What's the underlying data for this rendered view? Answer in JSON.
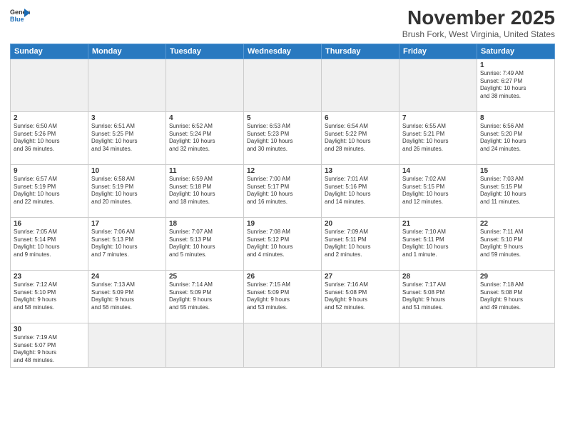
{
  "header": {
    "logo_general": "General",
    "logo_blue": "Blue",
    "month": "November 2025",
    "location": "Brush Fork, West Virginia, United States"
  },
  "weekdays": [
    "Sunday",
    "Monday",
    "Tuesday",
    "Wednesday",
    "Thursday",
    "Friday",
    "Saturday"
  ],
  "weeks": [
    [
      {
        "day": "",
        "info": "",
        "empty": true
      },
      {
        "day": "",
        "info": "",
        "empty": true
      },
      {
        "day": "",
        "info": "",
        "empty": true
      },
      {
        "day": "",
        "info": "",
        "empty": true
      },
      {
        "day": "",
        "info": "",
        "empty": true
      },
      {
        "day": "",
        "info": "",
        "empty": true
      },
      {
        "day": "1",
        "info": "Sunrise: 7:49 AM\nSunset: 6:27 PM\nDaylight: 10 hours\nand 38 minutes."
      }
    ],
    [
      {
        "day": "2",
        "info": "Sunrise: 6:50 AM\nSunset: 5:26 PM\nDaylight: 10 hours\nand 36 minutes."
      },
      {
        "day": "3",
        "info": "Sunrise: 6:51 AM\nSunset: 5:25 PM\nDaylight: 10 hours\nand 34 minutes."
      },
      {
        "day": "4",
        "info": "Sunrise: 6:52 AM\nSunset: 5:24 PM\nDaylight: 10 hours\nand 32 minutes."
      },
      {
        "day": "5",
        "info": "Sunrise: 6:53 AM\nSunset: 5:23 PM\nDaylight: 10 hours\nand 30 minutes."
      },
      {
        "day": "6",
        "info": "Sunrise: 6:54 AM\nSunset: 5:22 PM\nDaylight: 10 hours\nand 28 minutes."
      },
      {
        "day": "7",
        "info": "Sunrise: 6:55 AM\nSunset: 5:21 PM\nDaylight: 10 hours\nand 26 minutes."
      },
      {
        "day": "8",
        "info": "Sunrise: 6:56 AM\nSunset: 5:20 PM\nDaylight: 10 hours\nand 24 minutes."
      }
    ],
    [
      {
        "day": "9",
        "info": "Sunrise: 6:57 AM\nSunset: 5:19 PM\nDaylight: 10 hours\nand 22 minutes."
      },
      {
        "day": "10",
        "info": "Sunrise: 6:58 AM\nSunset: 5:19 PM\nDaylight: 10 hours\nand 20 minutes."
      },
      {
        "day": "11",
        "info": "Sunrise: 6:59 AM\nSunset: 5:18 PM\nDaylight: 10 hours\nand 18 minutes."
      },
      {
        "day": "12",
        "info": "Sunrise: 7:00 AM\nSunset: 5:17 PM\nDaylight: 10 hours\nand 16 minutes."
      },
      {
        "day": "13",
        "info": "Sunrise: 7:01 AM\nSunset: 5:16 PM\nDaylight: 10 hours\nand 14 minutes."
      },
      {
        "day": "14",
        "info": "Sunrise: 7:02 AM\nSunset: 5:15 PM\nDaylight: 10 hours\nand 12 minutes."
      },
      {
        "day": "15",
        "info": "Sunrise: 7:03 AM\nSunset: 5:15 PM\nDaylight: 10 hours\nand 11 minutes."
      }
    ],
    [
      {
        "day": "16",
        "info": "Sunrise: 7:05 AM\nSunset: 5:14 PM\nDaylight: 10 hours\nand 9 minutes."
      },
      {
        "day": "17",
        "info": "Sunrise: 7:06 AM\nSunset: 5:13 PM\nDaylight: 10 hours\nand 7 minutes."
      },
      {
        "day": "18",
        "info": "Sunrise: 7:07 AM\nSunset: 5:13 PM\nDaylight: 10 hours\nand 5 minutes."
      },
      {
        "day": "19",
        "info": "Sunrise: 7:08 AM\nSunset: 5:12 PM\nDaylight: 10 hours\nand 4 minutes."
      },
      {
        "day": "20",
        "info": "Sunrise: 7:09 AM\nSunset: 5:11 PM\nDaylight: 10 hours\nand 2 minutes."
      },
      {
        "day": "21",
        "info": "Sunrise: 7:10 AM\nSunset: 5:11 PM\nDaylight: 10 hours\nand 1 minute."
      },
      {
        "day": "22",
        "info": "Sunrise: 7:11 AM\nSunset: 5:10 PM\nDaylight: 9 hours\nand 59 minutes."
      }
    ],
    [
      {
        "day": "23",
        "info": "Sunrise: 7:12 AM\nSunset: 5:10 PM\nDaylight: 9 hours\nand 58 minutes."
      },
      {
        "day": "24",
        "info": "Sunrise: 7:13 AM\nSunset: 5:09 PM\nDaylight: 9 hours\nand 56 minutes."
      },
      {
        "day": "25",
        "info": "Sunrise: 7:14 AM\nSunset: 5:09 PM\nDaylight: 9 hours\nand 55 minutes."
      },
      {
        "day": "26",
        "info": "Sunrise: 7:15 AM\nSunset: 5:09 PM\nDaylight: 9 hours\nand 53 minutes."
      },
      {
        "day": "27",
        "info": "Sunrise: 7:16 AM\nSunset: 5:08 PM\nDaylight: 9 hours\nand 52 minutes."
      },
      {
        "day": "28",
        "info": "Sunrise: 7:17 AM\nSunset: 5:08 PM\nDaylight: 9 hours\nand 51 minutes."
      },
      {
        "day": "29",
        "info": "Sunrise: 7:18 AM\nSunset: 5:08 PM\nDaylight: 9 hours\nand 49 minutes."
      }
    ],
    [
      {
        "day": "30",
        "info": "Sunrise: 7:19 AM\nSunset: 5:07 PM\nDaylight: 9 hours\nand 48 minutes.",
        "last": true
      },
      {
        "day": "",
        "info": "",
        "empty": true,
        "last": true
      },
      {
        "day": "",
        "info": "",
        "empty": true,
        "last": true
      },
      {
        "day": "",
        "info": "",
        "empty": true,
        "last": true
      },
      {
        "day": "",
        "info": "",
        "empty": true,
        "last": true
      },
      {
        "day": "",
        "info": "",
        "empty": true,
        "last": true
      },
      {
        "day": "",
        "info": "",
        "empty": true,
        "last": true
      }
    ]
  ]
}
